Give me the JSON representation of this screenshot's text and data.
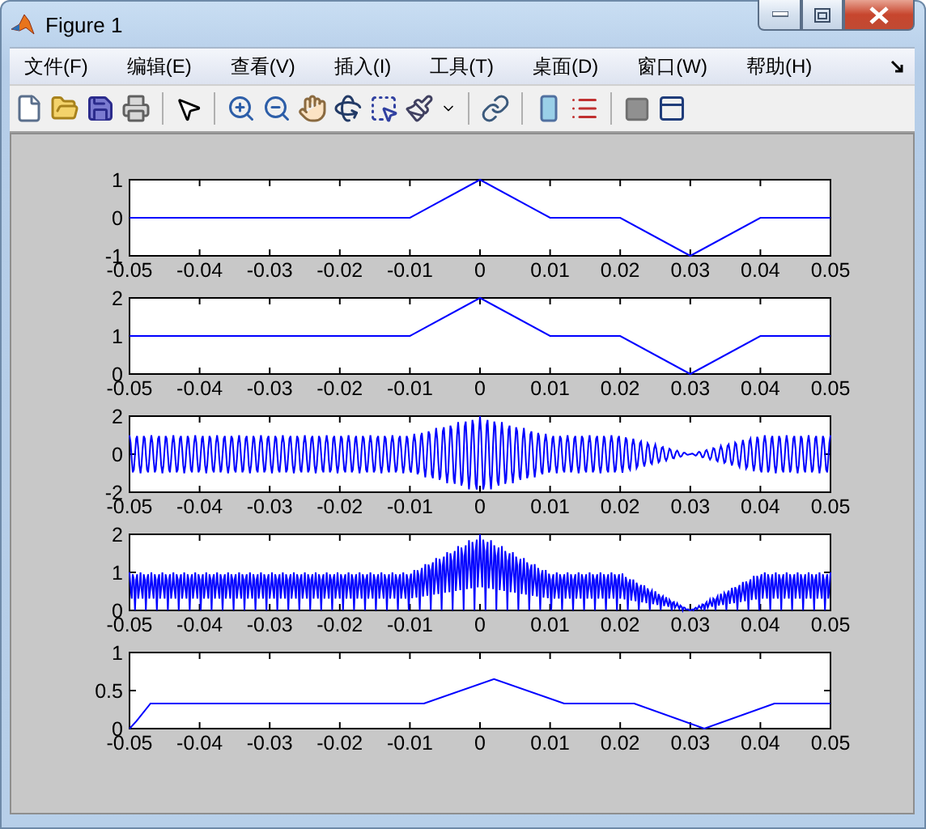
{
  "window": {
    "title": "Figure 1"
  },
  "menu": [
    "文件(F)",
    "编辑(E)",
    "查看(V)",
    "插入(I)",
    "工具(T)",
    "桌面(D)",
    "窗口(W)",
    "帮助(H)"
  ],
  "plots": [
    {
      "kind": "line",
      "chart_data": {
        "type": "line",
        "x": [
          -0.05,
          -0.01,
          0,
          0.01,
          0.02,
          0.03,
          0.04,
          0.05
        ],
        "series": [
          {
            "color": "#0000ff",
            "values": [
              0,
              0,
              1,
              0,
              0,
              -1,
              0,
              0
            ]
          }
        ],
        "xlim": [
          -0.05,
          0.05
        ],
        "ylim": [
          -1,
          1
        ],
        "xticks": [
          -0.05,
          -0.04,
          -0.03,
          -0.02,
          -0.01,
          0,
          0.01,
          0.02,
          0.03,
          0.04,
          0.05
        ],
        "yticks": [
          -1,
          0,
          1
        ]
      }
    },
    {
      "kind": "line",
      "chart_data": {
        "type": "line",
        "x": [
          -0.05,
          -0.01,
          0,
          0.01,
          0.02,
          0.03,
          0.04,
          0.05
        ],
        "series": [
          {
            "color": "#0000ff",
            "values": [
              1,
              1,
              2,
              1,
              1,
              0,
              1,
              1
            ]
          }
        ],
        "xlim": [
          -0.05,
          0.05
        ],
        "ylim": [
          0,
          2
        ],
        "xticks": [
          -0.05,
          -0.04,
          -0.03,
          -0.02,
          -0.01,
          0,
          0.01,
          0.02,
          0.03,
          0.04,
          0.05
        ],
        "yticks": [
          0,
          1,
          2
        ]
      }
    },
    {
      "kind": "wave",
      "rectified": false,
      "xticks": [
        "-0.05",
        "-0.04",
        "-0.03",
        "-0.02",
        "-0.01",
        "0",
        "0.01",
        "0.02",
        "0.03",
        "0.04",
        "0.05"
      ],
      "yticks": [
        "2",
        "0",
        "-2"
      ]
    },
    {
      "kind": "wave",
      "rectified": true,
      "xticks": [
        "-0.05",
        "-0.04",
        "-0.03",
        "-0.02",
        "-0.01",
        "0",
        "0.01",
        "0.02",
        "0.03",
        "0.04",
        "0.05"
      ],
      "yticks": [
        "2",
        "1",
        "0"
      ]
    },
    {
      "kind": "line",
      "chart_data": {
        "type": "line",
        "x": [
          -0.05,
          -0.049,
          -0.047,
          -0.008,
          0.002,
          0.012,
          0.022,
          0.032,
          0.042,
          0.05
        ],
        "series": [
          {
            "color": "#0000ff",
            "values": [
              0,
              0.1,
              0.33,
              0.33,
              0.65,
              0.33,
              0.33,
              0,
              0.33,
              0.33
            ]
          }
        ],
        "xlim": [
          -0.05,
          0.05
        ],
        "ylim": [
          0,
          1
        ],
        "xticks": [
          -0.05,
          -0.04,
          -0.03,
          -0.02,
          -0.01,
          0,
          0.01,
          0.02,
          0.03,
          0.04,
          0.05
        ],
        "yticks": [
          0,
          0.5,
          1
        ]
      }
    }
  ]
}
